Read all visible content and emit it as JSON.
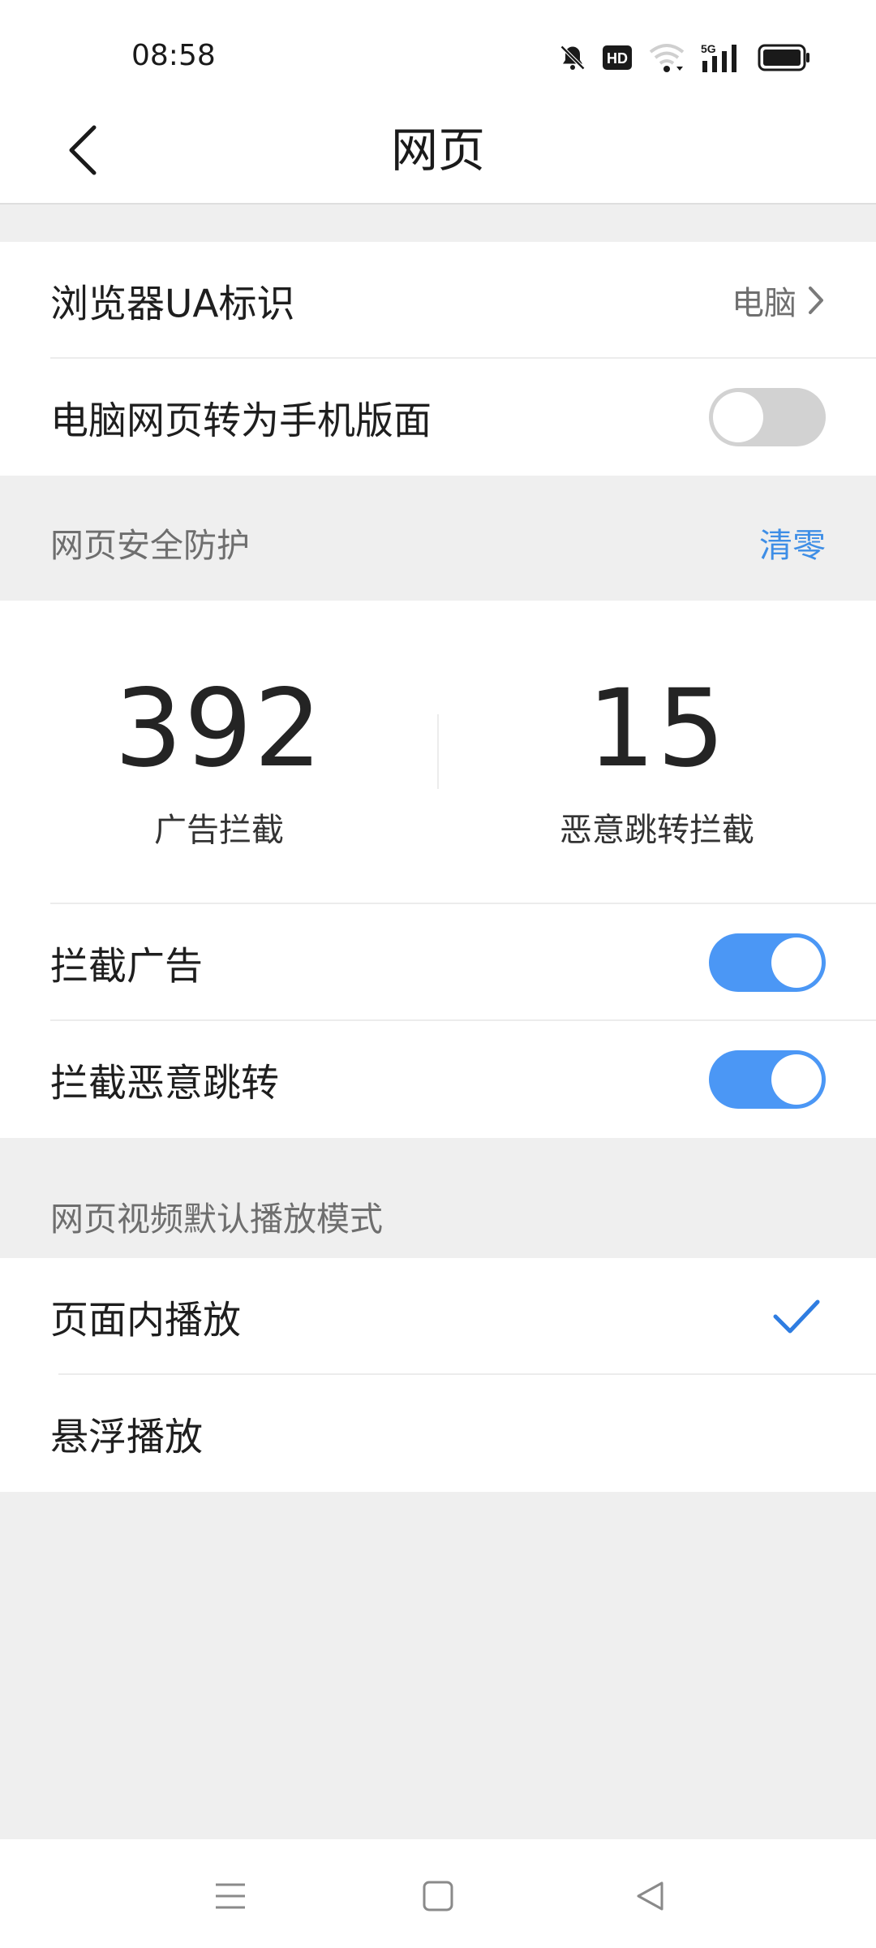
{
  "status_bar": {
    "time": "08:58",
    "icons": [
      "bell-off-icon",
      "hd-icon",
      "wifi-icon",
      "5g-signal-icon",
      "battery-icon"
    ],
    "network_label": "5G",
    "hd_label": "HD"
  },
  "header": {
    "title": "网页",
    "back_icon": "chevron-left-icon"
  },
  "general": {
    "ua_label": "浏览器UA标识",
    "ua_value": "电脑",
    "desktop_to_mobile_label": "电脑网页转为手机版面",
    "desktop_to_mobile_enabled": false
  },
  "security": {
    "header": "网页安全防护",
    "clear_label": "清零",
    "ad_block_count": "392",
    "ad_block_label": "广告拦截",
    "redirect_block_count": "15",
    "redirect_block_label": "恶意跳转拦截",
    "block_ads_label": "拦截广告",
    "block_ads_enabled": true,
    "block_redirect_label": "拦截恶意跳转",
    "block_redirect_enabled": true
  },
  "video": {
    "header": "网页视频默认播放模式",
    "options": [
      {
        "label": "页面内播放",
        "selected": true
      },
      {
        "label": "悬浮播放",
        "selected": false
      }
    ]
  },
  "nav_bar": {
    "icons": [
      "menu-icon",
      "home-square-icon",
      "back-triangle-icon"
    ]
  },
  "colors": {
    "accent": "#4b97f5",
    "link": "#3e8ee6",
    "check": "#2f7de1",
    "background": "#efefef"
  }
}
